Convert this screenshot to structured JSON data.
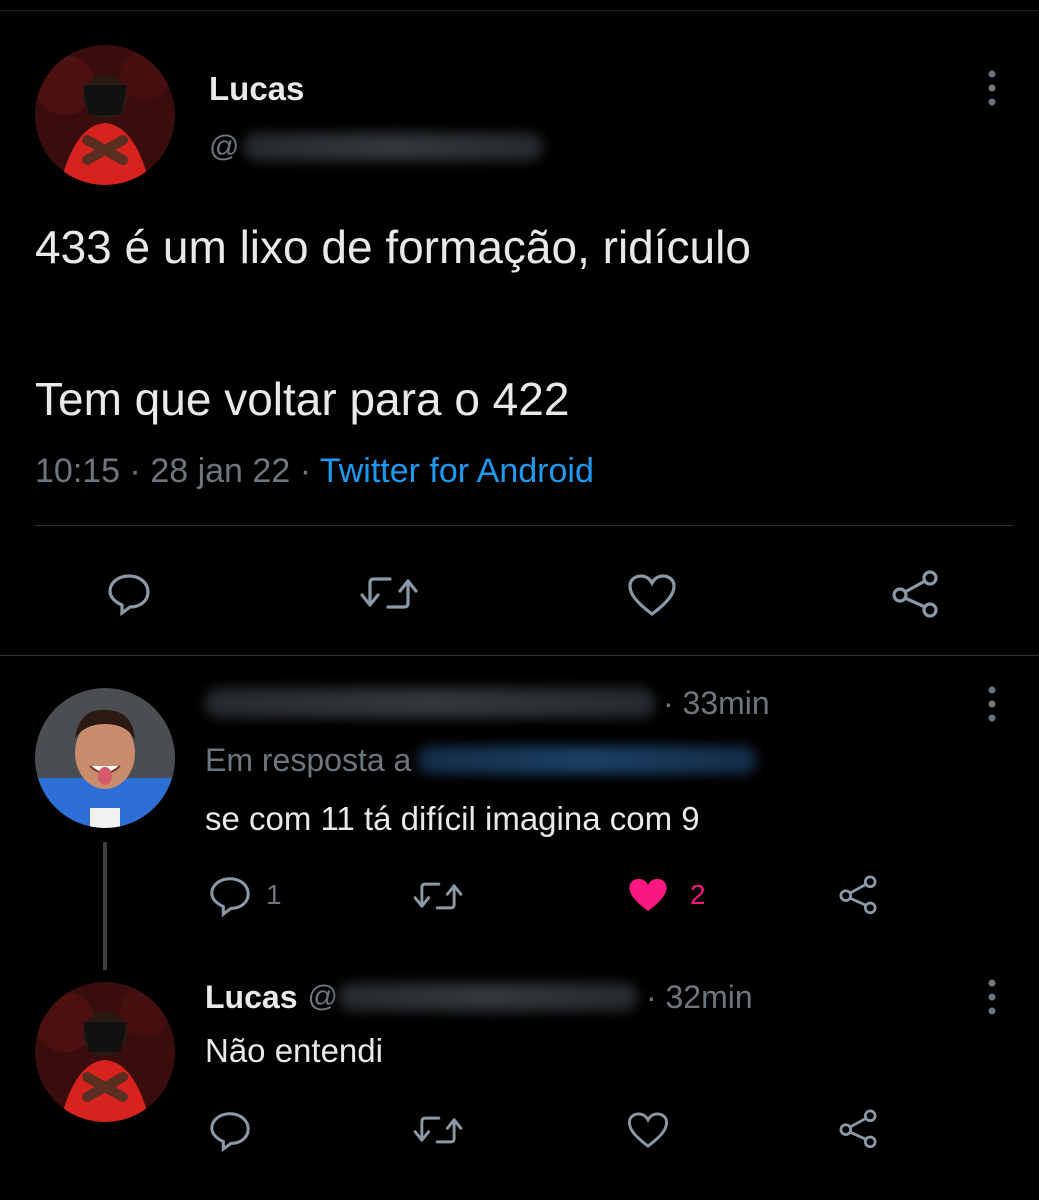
{
  "main_tweet": {
    "author_name": "Lucas",
    "handle_prefix": "@",
    "text_line1": "433 é um lixo de formação, ridículo",
    "text_line2": "Tem que voltar para o 422",
    "time": "10:15",
    "sep1": "·",
    "date": "28 jan 22",
    "sep2": "·",
    "source": "Twitter for Android"
  },
  "reply1": {
    "time": "· 33min",
    "reply_to_prefix": "Em resposta a",
    "text": "se com 11 tá difícil imagina com 9",
    "reply_count": "1",
    "like_count": "2"
  },
  "reply2": {
    "author_name": "Lucas",
    "handle_prefix": "@",
    "time": "· 32min",
    "text": "Não entendi"
  },
  "icons": {
    "reply": "speech-bubble-icon",
    "retweet": "retweet-icon",
    "like": "heart-icon",
    "share": "share-icon",
    "more": "more-dots-icon"
  },
  "colors": {
    "background": "#000000",
    "text": "#e7e9ea",
    "muted": "#6e767d",
    "link": "#1d9bf0",
    "like_active": "#f91880"
  }
}
